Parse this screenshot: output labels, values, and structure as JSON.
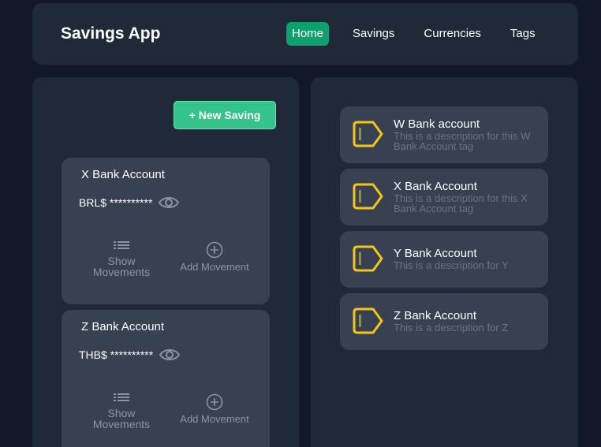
{
  "header": {
    "title": "Savings App",
    "nav": [
      "Home",
      "Savings",
      "Currencies",
      "Tags"
    ],
    "active_nav": "Home"
  },
  "savings": {
    "new_button": "+ New Saving",
    "cards": [
      {
        "name": "X Bank Account",
        "balance": "BRL$ **********",
        "show_movements": "Show Movements",
        "add_movement": "Add Movement"
      },
      {
        "name": "Z Bank Account",
        "balance": "THB$ **********",
        "show_movements": "Show Movements",
        "add_movement": "Add Movement"
      }
    ]
  },
  "tags": [
    {
      "name": "W Bank account",
      "description": "This is a description for this W Bank Account tag",
      "icon": "tag-icon"
    },
    {
      "name": "X Bank Account",
      "description": "This is a description for this X Bank Account tag",
      "icon": "tag-icon"
    },
    {
      "name": "Y Bank Account",
      "description": "This is a description for Y",
      "icon": "tag-icon"
    },
    {
      "name": "Z Bank Account",
      "description": "This is a description for Z",
      "icon": "tag-icon"
    }
  ],
  "colors": {
    "background": "#121827",
    "panel": "#1f2937",
    "card": "#374151",
    "active_nav": "#10a06d",
    "new_button": "#34c48b",
    "tag_icon": "#f5c518"
  }
}
